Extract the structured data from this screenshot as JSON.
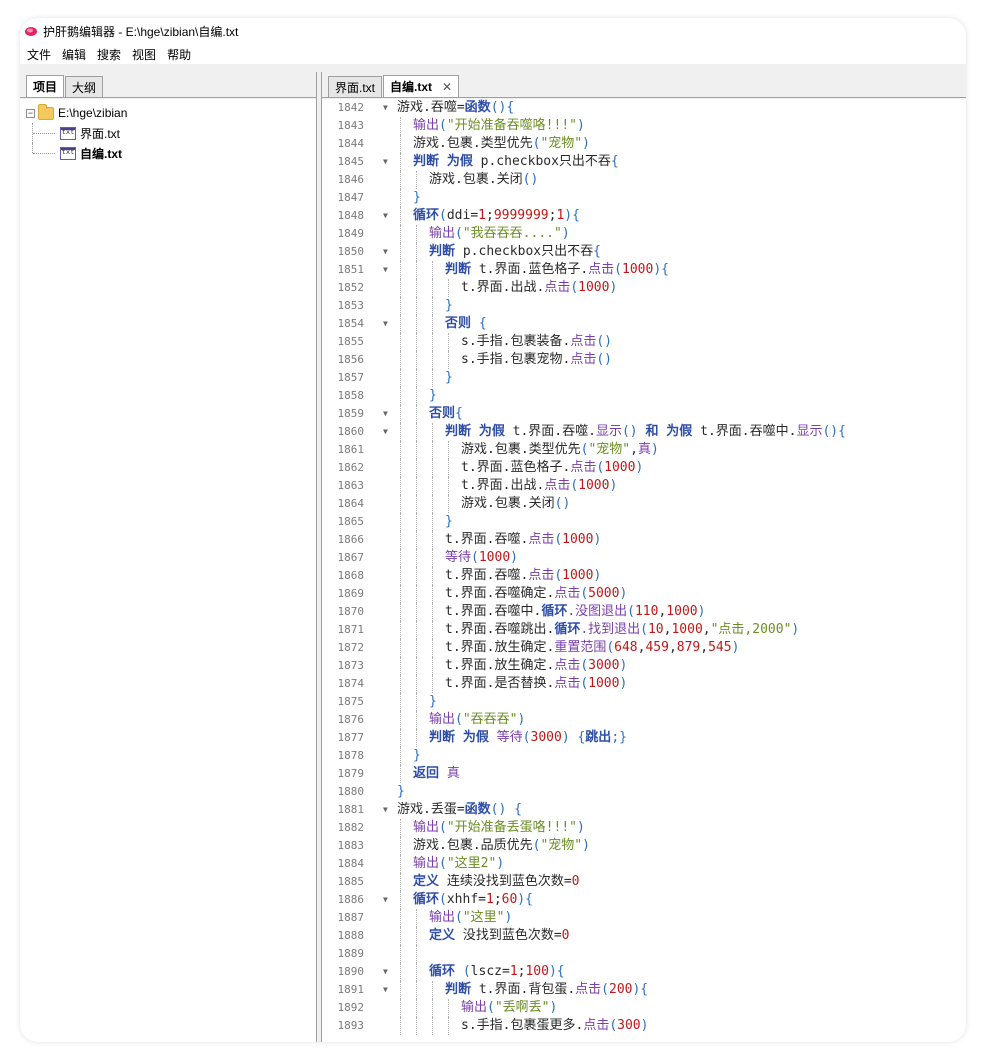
{
  "window": {
    "title": "护肝鹅编辑器 - E:\\hge\\zibian\\自编.txt"
  },
  "menu": [
    "文件",
    "编辑",
    "搜索",
    "视图",
    "帮助"
  ],
  "left_tabs": [
    "项目",
    "大纲"
  ],
  "tree": {
    "root": "E:\\hge\\zibian",
    "children": [
      {
        "label": "界面.txt",
        "bold": false
      },
      {
        "label": "自编.txt",
        "bold": true
      }
    ],
    "file_icon_text": "txt"
  },
  "doc_tabs": [
    "界面.txt",
    "自编.txt"
  ],
  "close_glyph": "✕",
  "lines": [
    {
      "n": "1842",
      "d": 0,
      "f": true,
      "t": [
        [
          "游戏",
          "plain"
        ],
        [
          ".吞噬=",
          "plain"
        ],
        [
          "函数",
          "kw"
        ],
        [
          "(){",
          "paren"
        ]
      ]
    },
    {
      "n": "1843",
      "d": 1,
      "f": false,
      "t": [
        [
          "输出",
          "fn"
        ],
        [
          "(",
          "paren"
        ],
        [
          "\"开始准备吞噬咯!!!\"",
          "str"
        ],
        [
          ")",
          "paren"
        ]
      ]
    },
    {
      "n": "1844",
      "d": 1,
      "f": false,
      "t": [
        [
          "游戏.包裹.类型优先",
          "plain"
        ],
        [
          "(",
          "paren"
        ],
        [
          "\"宠物\"",
          "str"
        ],
        [
          ")",
          "paren"
        ]
      ]
    },
    {
      "n": "1845",
      "d": 1,
      "f": true,
      "t": [
        [
          "判断 为假",
          "kw"
        ],
        [
          " p.checkbox只出不吞",
          "plain"
        ],
        [
          "{",
          "paren"
        ]
      ]
    },
    {
      "n": "1846",
      "d": 2,
      "f": false,
      "t": [
        [
          "游戏.包裹.关闭",
          "plain"
        ],
        [
          "()",
          "paren"
        ]
      ]
    },
    {
      "n": "1847",
      "d": 1,
      "f": false,
      "t": [
        [
          "}",
          "paren"
        ]
      ]
    },
    {
      "n": "1848",
      "d": 1,
      "f": true,
      "t": [
        [
          "循环",
          "kw"
        ],
        [
          "(",
          "paren"
        ],
        [
          "ddi=",
          "plain"
        ],
        [
          "1",
          "num"
        ],
        [
          ";",
          "plain"
        ],
        [
          "9999999",
          "num"
        ],
        [
          ";",
          "plain"
        ],
        [
          "1",
          "num"
        ],
        [
          "){",
          "paren"
        ]
      ]
    },
    {
      "n": "1849",
      "d": 2,
      "f": false,
      "t": [
        [
          "输出",
          "fn"
        ],
        [
          "(",
          "paren"
        ],
        [
          "\"我吞吞吞....\"",
          "str"
        ],
        [
          ")",
          "paren"
        ]
      ]
    },
    {
      "n": "1850",
      "d": 2,
      "f": true,
      "t": [
        [
          "判断",
          "kw"
        ],
        [
          " p.checkbox只出不吞",
          "plain"
        ],
        [
          "{",
          "paren"
        ]
      ]
    },
    {
      "n": "1851",
      "d": 3,
      "f": true,
      "t": [
        [
          "判断",
          "kw"
        ],
        [
          " t.界面.蓝色格子.",
          "plain"
        ],
        [
          "点击",
          "fn"
        ],
        [
          "(",
          "paren"
        ],
        [
          "1000",
          "num"
        ],
        [
          "){",
          "paren"
        ]
      ]
    },
    {
      "n": "1852",
      "d": 4,
      "f": false,
      "t": [
        [
          "t.界面.出战.",
          "plain"
        ],
        [
          "点击",
          "fn"
        ],
        [
          "(",
          "paren"
        ],
        [
          "1000",
          "num"
        ],
        [
          ")",
          "paren"
        ]
      ]
    },
    {
      "n": "1853",
      "d": 3,
      "f": false,
      "t": [
        [
          "}",
          "paren"
        ]
      ]
    },
    {
      "n": "1854",
      "d": 3,
      "f": true,
      "t": [
        [
          "否则",
          "kw"
        ],
        [
          " {",
          "paren"
        ]
      ]
    },
    {
      "n": "1855",
      "d": 4,
      "f": false,
      "t": [
        [
          "s.手指.包裹装备.",
          "plain"
        ],
        [
          "点击",
          "fn"
        ],
        [
          "()",
          "paren"
        ]
      ]
    },
    {
      "n": "1856",
      "d": 4,
      "f": false,
      "t": [
        [
          "s.手指.包裹宠物.",
          "plain"
        ],
        [
          "点击",
          "fn"
        ],
        [
          "()",
          "paren"
        ]
      ]
    },
    {
      "n": "1857",
      "d": 3,
      "f": false,
      "t": [
        [
          "}",
          "paren"
        ]
      ]
    },
    {
      "n": "1858",
      "d": 2,
      "f": false,
      "t": [
        [
          "}",
          "paren"
        ]
      ]
    },
    {
      "n": "1859",
      "d": 2,
      "f": true,
      "t": [
        [
          "否则",
          "kw"
        ],
        [
          "{",
          "paren"
        ]
      ]
    },
    {
      "n": "1860",
      "d": 3,
      "f": true,
      "t": [
        [
          "判断 为假",
          "kw"
        ],
        [
          " t.界面.吞噬.",
          "plain"
        ],
        [
          "显示",
          "fn"
        ],
        [
          "() ",
          "paren"
        ],
        [
          "和 为假",
          "kw"
        ],
        [
          " t.界面.吞噬中.",
          "plain"
        ],
        [
          "显示",
          "fn"
        ],
        [
          "(){",
          "paren"
        ]
      ]
    },
    {
      "n": "1861",
      "d": 4,
      "f": false,
      "t": [
        [
          "游戏.包裹.类型优先",
          "plain"
        ],
        [
          "(",
          "paren"
        ],
        [
          "\"宠物\"",
          "str"
        ],
        [
          ",",
          "plain"
        ],
        [
          "真",
          "fn"
        ],
        [
          ")",
          "paren"
        ]
      ]
    },
    {
      "n": "1862",
      "d": 4,
      "f": false,
      "t": [
        [
          "t.界面.蓝色格子.",
          "plain"
        ],
        [
          "点击",
          "fn"
        ],
        [
          "(",
          "paren"
        ],
        [
          "1000",
          "num"
        ],
        [
          ")",
          "paren"
        ]
      ]
    },
    {
      "n": "1863",
      "d": 4,
      "f": false,
      "t": [
        [
          "t.界面.出战.",
          "plain"
        ],
        [
          "点击",
          "fn"
        ],
        [
          "(",
          "paren"
        ],
        [
          "1000",
          "num"
        ],
        [
          ")",
          "paren"
        ]
      ]
    },
    {
      "n": "1864",
      "d": 4,
      "f": false,
      "t": [
        [
          "游戏.包裹.关闭",
          "plain"
        ],
        [
          "()",
          "paren"
        ]
      ]
    },
    {
      "n": "1865",
      "d": 3,
      "f": false,
      "t": [
        [
          "}",
          "paren"
        ]
      ]
    },
    {
      "n": "1866",
      "d": 3,
      "f": false,
      "t": [
        [
          "t.界面.吞噬.",
          "plain"
        ],
        [
          "点击",
          "fn"
        ],
        [
          "(",
          "paren"
        ],
        [
          "1000",
          "num"
        ],
        [
          ")",
          "paren"
        ]
      ]
    },
    {
      "n": "1867",
      "d": 3,
      "f": false,
      "t": [
        [
          "等待",
          "fn"
        ],
        [
          "(",
          "paren"
        ],
        [
          "1000",
          "num"
        ],
        [
          ")",
          "paren"
        ]
      ]
    },
    {
      "n": "1868",
      "d": 3,
      "f": false,
      "t": [
        [
          "t.界面.吞噬.",
          "plain"
        ],
        [
          "点击",
          "fn"
        ],
        [
          "(",
          "paren"
        ],
        [
          "1000",
          "num"
        ],
        [
          ")",
          "paren"
        ]
      ]
    },
    {
      "n": "1869",
      "d": 3,
      "f": false,
      "t": [
        [
          "t.界面.吞噬确定.",
          "plain"
        ],
        [
          "点击",
          "fn"
        ],
        [
          "(",
          "paren"
        ],
        [
          "5000",
          "num"
        ],
        [
          ")",
          "paren"
        ]
      ]
    },
    {
      "n": "1870",
      "d": 3,
      "f": false,
      "t": [
        [
          "t.界面.吞噬中.",
          "plain"
        ],
        [
          "循环",
          "kw"
        ],
        [
          ".没图退出",
          "fn"
        ],
        [
          "(",
          "paren"
        ],
        [
          "110",
          "num"
        ],
        [
          ",",
          "plain"
        ],
        [
          "1000",
          "num"
        ],
        [
          ")",
          "paren"
        ]
      ]
    },
    {
      "n": "1871",
      "d": 3,
      "f": false,
      "t": [
        [
          "t.界面.吞噬跳出.",
          "plain"
        ],
        [
          "循环",
          "kw"
        ],
        [
          ".找到退出",
          "fn"
        ],
        [
          "(",
          "paren"
        ],
        [
          "10",
          "num"
        ],
        [
          ",",
          "plain"
        ],
        [
          "1000",
          "num"
        ],
        [
          ",",
          "plain"
        ],
        [
          "\"点击,2000\"",
          "str"
        ],
        [
          ")",
          "paren"
        ]
      ]
    },
    {
      "n": "1872",
      "d": 3,
      "f": false,
      "t": [
        [
          "t.界面.放生确定.",
          "plain"
        ],
        [
          "重置范围",
          "fn"
        ],
        [
          "(",
          "paren"
        ],
        [
          "648",
          "num"
        ],
        [
          ",",
          "plain"
        ],
        [
          "459",
          "num"
        ],
        [
          ",",
          "plain"
        ],
        [
          "879",
          "num"
        ],
        [
          ",",
          "plain"
        ],
        [
          "545",
          "num"
        ],
        [
          ")",
          "paren"
        ]
      ]
    },
    {
      "n": "1873",
      "d": 3,
      "f": false,
      "t": [
        [
          "t.界面.放生确定.",
          "plain"
        ],
        [
          "点击",
          "fn"
        ],
        [
          "(",
          "paren"
        ],
        [
          "3000",
          "num"
        ],
        [
          ")",
          "paren"
        ]
      ]
    },
    {
      "n": "1874",
      "d": 3,
      "f": false,
      "t": [
        [
          "t.界面.是否替换.",
          "plain"
        ],
        [
          "点击",
          "fn"
        ],
        [
          "(",
          "paren"
        ],
        [
          "1000",
          "num"
        ],
        [
          ")",
          "paren"
        ]
      ]
    },
    {
      "n": "1875",
      "d": 2,
      "f": false,
      "t": [
        [
          "}",
          "paren"
        ]
      ]
    },
    {
      "n": "1876",
      "d": 2,
      "f": false,
      "t": [
        [
          "输出",
          "fn"
        ],
        [
          "(",
          "paren"
        ],
        [
          "\"吞吞吞\"",
          "str"
        ],
        [
          ")",
          "paren"
        ]
      ]
    },
    {
      "n": "1877",
      "d": 2,
      "f": false,
      "t": [
        [
          "判断 为假",
          "kw"
        ],
        [
          " ",
          "plain"
        ],
        [
          "等待",
          "fn"
        ],
        [
          "(",
          "paren"
        ],
        [
          "3000",
          "num"
        ],
        [
          ") {",
          "paren"
        ],
        [
          "跳出",
          "kw"
        ],
        [
          ";}",
          "paren"
        ]
      ]
    },
    {
      "n": "1878",
      "d": 1,
      "f": false,
      "t": [
        [
          "}",
          "paren"
        ]
      ]
    },
    {
      "n": "1879",
      "d": 1,
      "f": false,
      "t": [
        [
          "返回",
          "kw"
        ],
        [
          " ",
          "plain"
        ],
        [
          "真",
          "fn"
        ]
      ]
    },
    {
      "n": "1880",
      "d": 0,
      "f": false,
      "t": [
        [
          "}",
          "paren"
        ]
      ]
    },
    {
      "n": "1881",
      "d": 0,
      "f": true,
      "t": [
        [
          "游戏.丢蛋=",
          "plain"
        ],
        [
          "函数",
          "kw"
        ],
        [
          "() {",
          "paren"
        ]
      ]
    },
    {
      "n": "1882",
      "d": 1,
      "f": false,
      "t": [
        [
          "输出",
          "fn"
        ],
        [
          "(",
          "paren"
        ],
        [
          "\"开始准备丢蛋咯!!!\"",
          "str"
        ],
        [
          ")",
          "paren"
        ]
      ]
    },
    {
      "n": "1883",
      "d": 1,
      "f": false,
      "t": [
        [
          "游戏.包裹.品质优先",
          "plain"
        ],
        [
          "(",
          "paren"
        ],
        [
          "\"宠物\"",
          "str"
        ],
        [
          ")",
          "paren"
        ]
      ]
    },
    {
      "n": "1884",
      "d": 1,
      "f": false,
      "t": [
        [
          "输出",
          "fn"
        ],
        [
          "(",
          "paren"
        ],
        [
          "\"这里2\"",
          "str"
        ],
        [
          ")",
          "paren"
        ]
      ]
    },
    {
      "n": "1885",
      "d": 1,
      "f": false,
      "t": [
        [
          "定义",
          "kw"
        ],
        [
          " 连续没找到蓝色次数=",
          "plain"
        ],
        [
          "0",
          "num"
        ]
      ]
    },
    {
      "n": "1886",
      "d": 1,
      "f": true,
      "t": [
        [
          "循环",
          "kw"
        ],
        [
          "(",
          "paren"
        ],
        [
          "xhhf=",
          "plain"
        ],
        [
          "1",
          "num"
        ],
        [
          ";",
          "plain"
        ],
        [
          "60",
          "num"
        ],
        [
          "){",
          "paren"
        ]
      ]
    },
    {
      "n": "1887",
      "d": 2,
      "f": false,
      "t": [
        [
          "输出",
          "fn"
        ],
        [
          "(",
          "paren"
        ],
        [
          "\"这里\"",
          "str"
        ],
        [
          ")",
          "paren"
        ]
      ]
    },
    {
      "n": "1888",
      "d": 2,
      "f": false,
      "t": [
        [
          "定义",
          "kw"
        ],
        [
          " 没找到蓝色次数=",
          "plain"
        ],
        [
          "0",
          "num"
        ]
      ]
    },
    {
      "n": "1889",
      "d": 2,
      "f": false,
      "t": []
    },
    {
      "n": "1890",
      "d": 2,
      "f": true,
      "t": [
        [
          "循环",
          "kw"
        ],
        [
          " (",
          "paren"
        ],
        [
          "lscz=",
          "plain"
        ],
        [
          "1",
          "num"
        ],
        [
          ";",
          "plain"
        ],
        [
          "100",
          "num"
        ],
        [
          "){",
          "paren"
        ]
      ]
    },
    {
      "n": "1891",
      "d": 3,
      "f": true,
      "t": [
        [
          "判断",
          "kw"
        ],
        [
          " t.界面.背包蛋.",
          "plain"
        ],
        [
          "点击",
          "fn"
        ],
        [
          "(",
          "paren"
        ],
        [
          "200",
          "num"
        ],
        [
          "){",
          "paren"
        ]
      ]
    },
    {
      "n": "1892",
      "d": 4,
      "f": false,
      "t": [
        [
          "输出",
          "fn"
        ],
        [
          "(",
          "paren"
        ],
        [
          "\"丢啊丢\"",
          "str"
        ],
        [
          ")",
          "paren"
        ]
      ]
    },
    {
      "n": "1893",
      "d": 4,
      "f": false,
      "t": [
        [
          "s.手指.包裹蛋更多.",
          "plain"
        ],
        [
          "点击",
          "fn"
        ],
        [
          "(",
          "paren"
        ],
        [
          "300",
          "num"
        ],
        [
          ")",
          "paren"
        ]
      ]
    }
  ]
}
